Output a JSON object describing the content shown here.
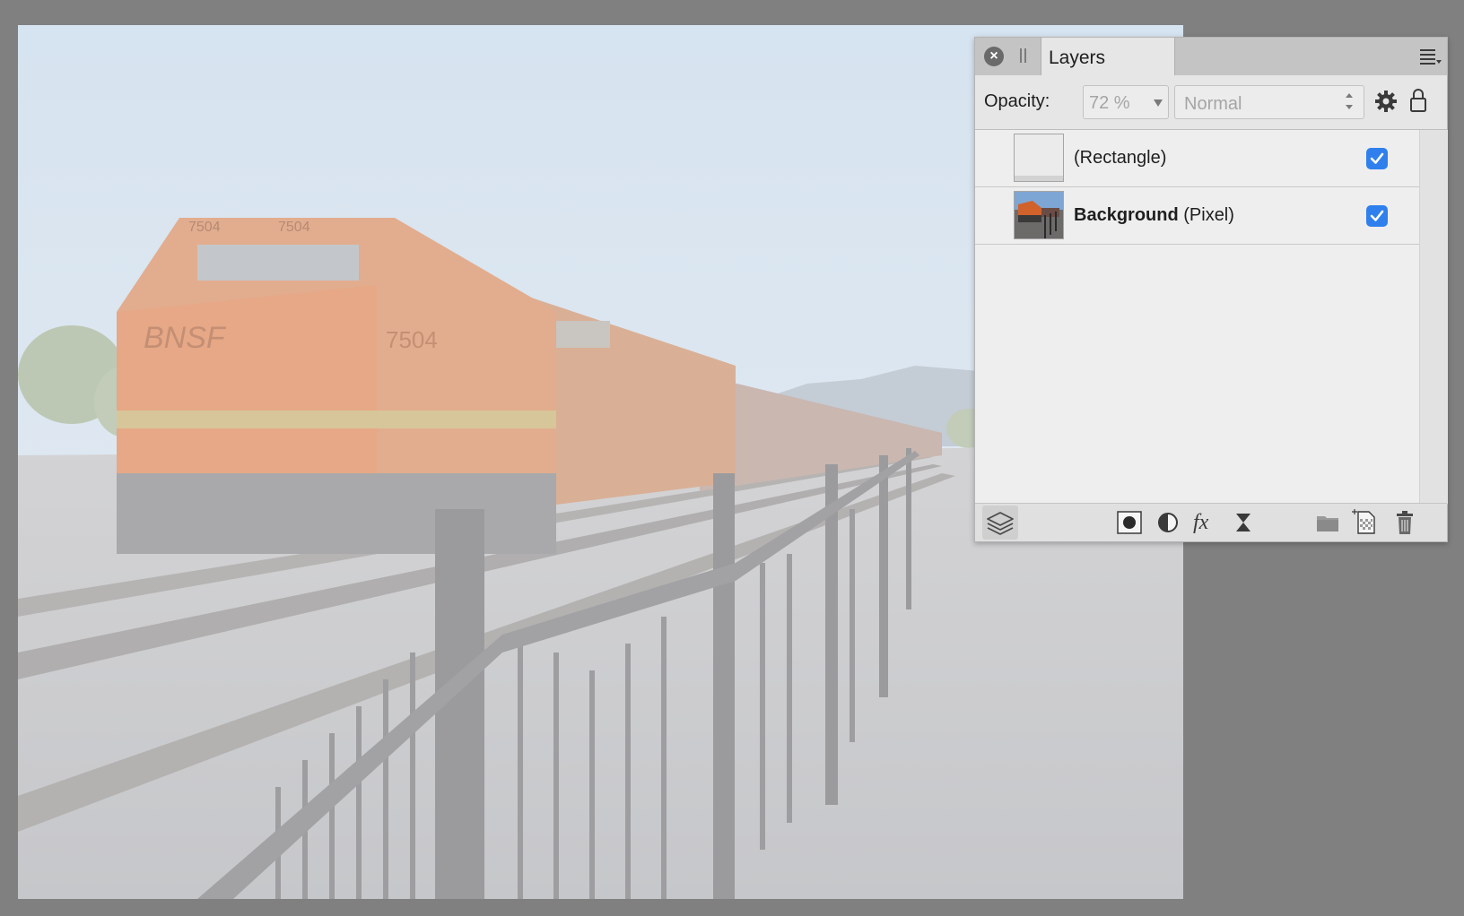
{
  "panel": {
    "tab_label": "Layers",
    "close_glyph": "×",
    "menu_icon": "panel-menu-icon"
  },
  "toolbar": {
    "opacity_label": "Opacity:",
    "opacity_value": "72 %",
    "blend_mode": "Normal"
  },
  "layers": [
    {
      "name_bold": "",
      "name_suffix": "(Rectangle)",
      "visible": true
    },
    {
      "name_bold": "Background",
      "name_suffix": " (Pixel)",
      "visible": true
    }
  ],
  "bottom_icons": [
    "layers-icon",
    "mask-icon",
    "adjustment-icon",
    "fx-icon",
    "live-filter-icon",
    "folder-icon",
    "new-pixel-layer-icon",
    "trash-icon"
  ],
  "colors": {
    "checkbox": "#2f80ed",
    "workspace": "#808080",
    "panel": "#e6e6e6"
  }
}
